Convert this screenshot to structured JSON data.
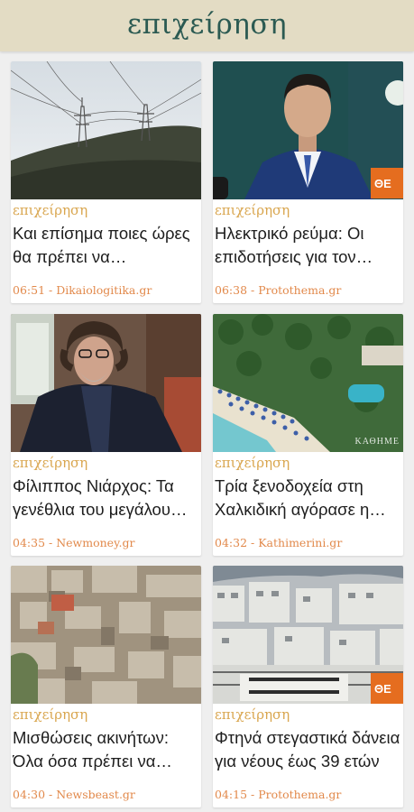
{
  "header": {
    "title": "επιχείρηση"
  },
  "articles": [
    {
      "category": "επιχείρηση",
      "title": "Και επίσημα ποιες ώρες θα πρέπει να «χρησιμοποιούμε» ρεύμα",
      "time": "06:51",
      "source": "Dikaiologitika.gr",
      "image": "power-lines-hill"
    },
    {
      "category": "επιχείρηση",
      "title": "Ηλεκτρικό ρεύμα: Οι επιδοτήσεις για τον Οκτώβριο",
      "time": "06:38",
      "source": "Protothema.gr",
      "image": "man-in-suit",
      "badge": "ΘΕ"
    },
    {
      "category": "επιχείρηση",
      "title": "Φίλιππος Νιάρχος: Τα γενέθλια του μεγάλου συλλέκτη",
      "time": "04:35",
      "source": "Newmoney.gr",
      "image": "curly-haired-man"
    },
    {
      "category": "επιχείρηση",
      "title": "Τρία ξενοδοχεία στη Χαλκιδική αγόρασε η εταιρεία",
      "time": "04:32",
      "source": "Kathimerini.gr",
      "image": "beach-resort",
      "watermark": "ΚΑΘΗΜΕ"
    },
    {
      "category": "επιχείρηση",
      "title": "Μισθώσεις ακινήτων: Όλα όσα πρέπει να ξέρετε",
      "time": "04:30",
      "source": "Newsbeast.gr",
      "image": "city-rooftops"
    },
    {
      "category": "επιχείρηση",
      "title": "Φτηνά στεγαστικά δάνεια για νέους έως 39 ετών",
      "time": "04:15",
      "source": "Protothema.gr",
      "image": "apartment-blocks",
      "badge": "ΘΕ"
    }
  ],
  "colors": {
    "header_bg": "#e3dcc4",
    "header_text": "#2b5a52",
    "category": "#d9a64f",
    "meta": "#e2894b",
    "badge": "#e56d1f"
  }
}
